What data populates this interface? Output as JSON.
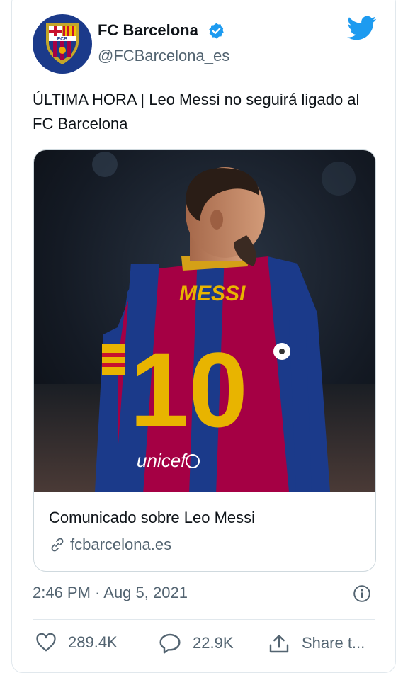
{
  "account": {
    "name": "FC Barcelona",
    "handle": "@FCBarcelona_es",
    "crest_text": "FCB"
  },
  "tweet": {
    "text": "ÚLTIMA HORA | Leo Messi no seguirá ligado al FC Barcelona"
  },
  "card": {
    "title": "Comunicado sobre Leo Messi",
    "domain": "fcbarcelona.es",
    "jersey_name": "MESSI",
    "jersey_number": "10",
    "sponsor": "unicef"
  },
  "meta": {
    "timestamp": "2:46 PM · Aug 5, 2021"
  },
  "actions": {
    "likes": "289.4K",
    "replies": "22.9K",
    "share_label": "Share t..."
  },
  "colors": {
    "twitter_blue": "#1d9bf0",
    "secondary_text": "#536471",
    "barca_blue": "#1b3a8a",
    "barca_red": "#a50044"
  }
}
